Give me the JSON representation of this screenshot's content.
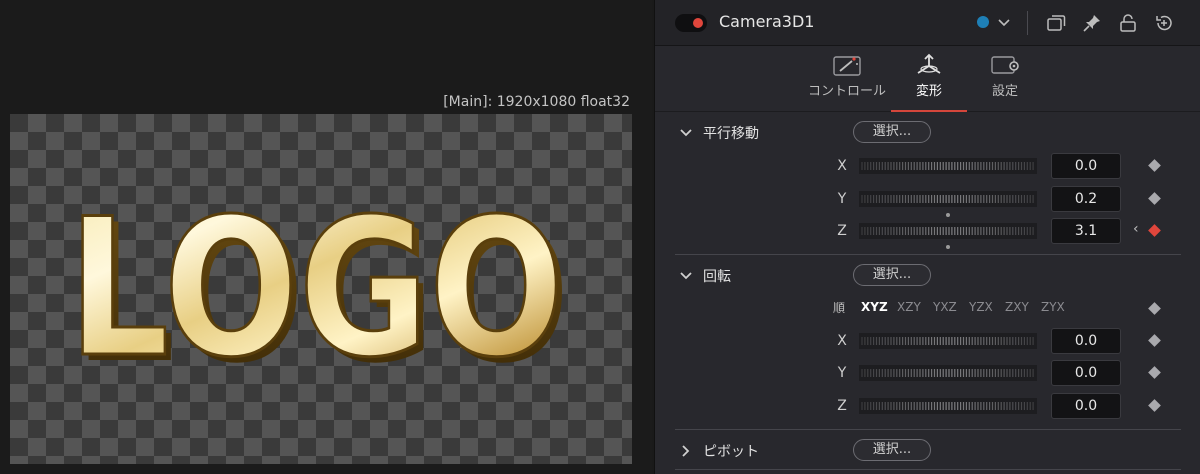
{
  "viewer": {
    "label": "[Main]: 1920x1080 float32",
    "logo_text": "LOGO"
  },
  "header": {
    "node_name": "Camera3D1",
    "node_color": "#1e7fb6",
    "icons": [
      "chevron-down-icon",
      "window-icon",
      "pin-icon",
      "lock-icon",
      "reset-icon"
    ]
  },
  "tabs": [
    {
      "label": "コントロール",
      "icon": "wand-icon",
      "active": false
    },
    {
      "label": "変形",
      "icon": "transform-icon",
      "active": true
    },
    {
      "label": "設定",
      "icon": "settings-icon",
      "active": false
    }
  ],
  "translation": {
    "title": "平行移動",
    "select_label": "選択...",
    "params": [
      {
        "axis": "X",
        "value": "0.0",
        "keyframe": "none"
      },
      {
        "axis": "Y",
        "value": "0.2",
        "keyframe": "none"
      },
      {
        "axis": "Z",
        "value": "3.1",
        "keyframe": "active"
      }
    ]
  },
  "rotation": {
    "title": "回転",
    "select_label": "選択...",
    "order_label": "順",
    "orders": [
      "XYZ",
      "XZY",
      "YXZ",
      "YZX",
      "ZXY",
      "ZYX"
    ],
    "selected_order": "XYZ",
    "params": [
      {
        "axis": "X",
        "value": "0.0"
      },
      {
        "axis": "Y",
        "value": "0.0"
      },
      {
        "axis": "Z",
        "value": "0.0"
      }
    ]
  },
  "pivot": {
    "title": "ピボット",
    "select_label": "選択..."
  },
  "colors": {
    "accent_red": "#e0463c",
    "panel_bg": "#28282d",
    "gold": "#d9b65a"
  }
}
